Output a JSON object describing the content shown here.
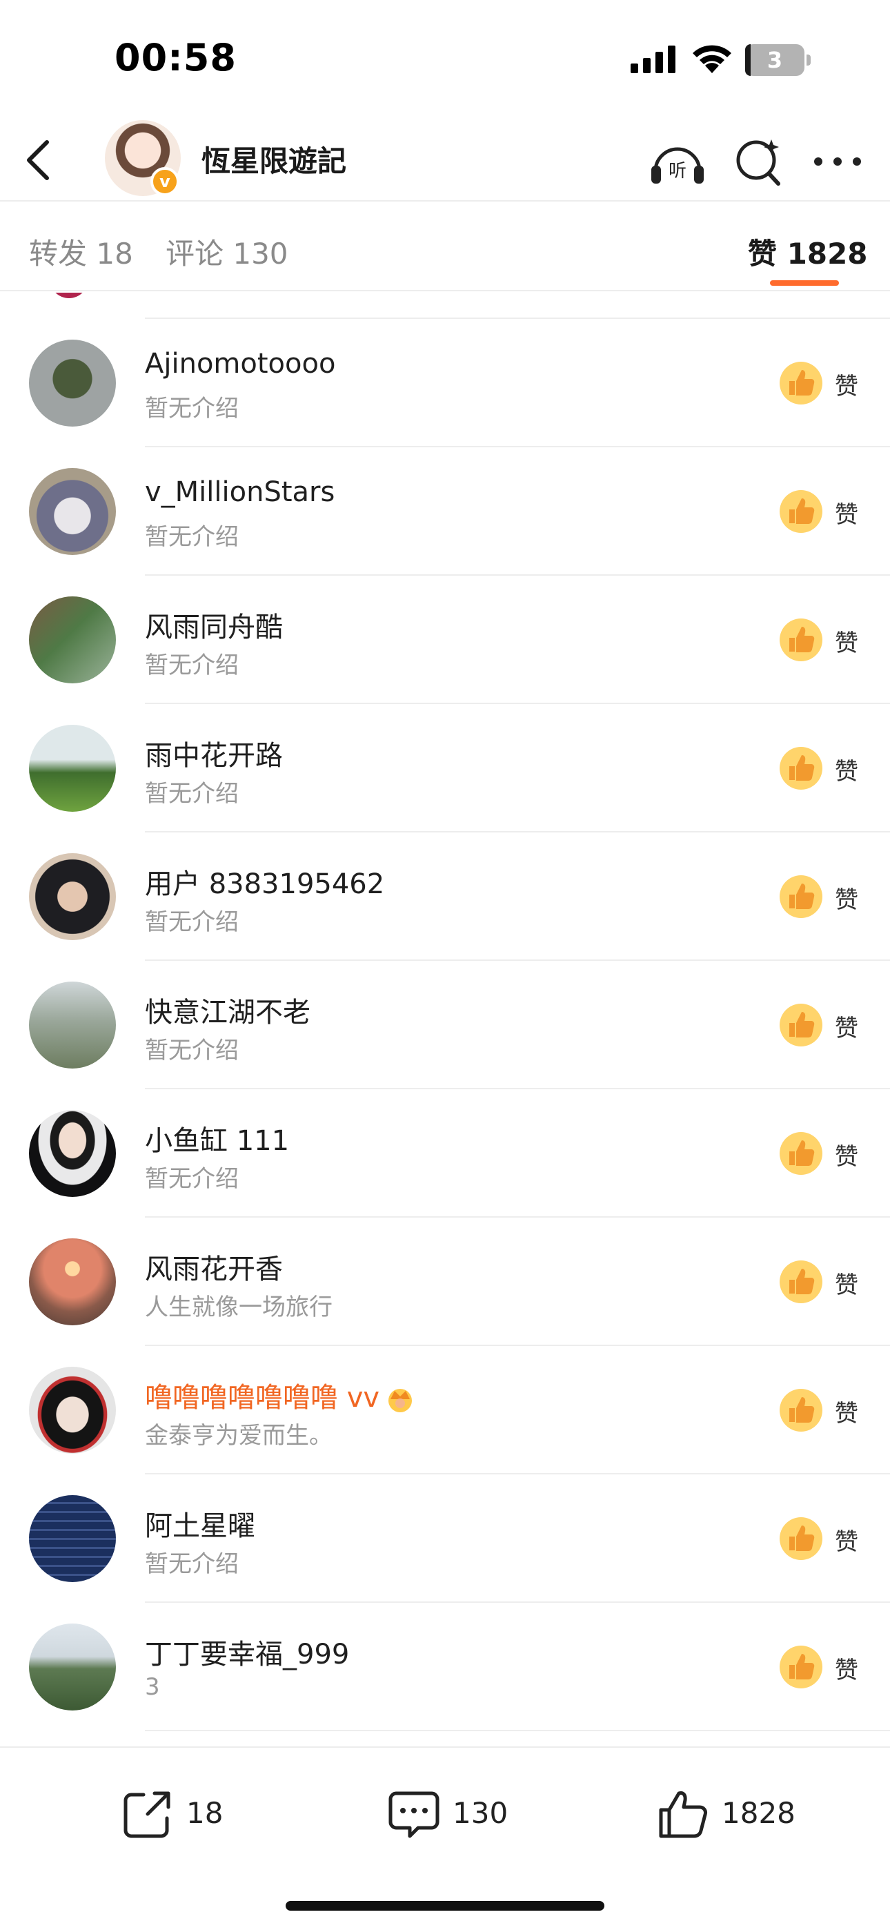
{
  "status_bar": {
    "time": "00:58",
    "battery": "3"
  },
  "nav": {
    "title": "恆星限遊記",
    "listen_icon_label": "听"
  },
  "tabs": [
    {
      "label": "转发 18"
    },
    {
      "label": "评论 130"
    },
    {
      "label": "赞 1828",
      "active": true
    }
  ],
  "likers": [
    {
      "name": "Ajinomotoooo",
      "bio": "暂无介绍",
      "action": "赞"
    },
    {
      "name": "v_MillionStars",
      "bio": "暂无介绍",
      "action": "赞"
    },
    {
      "name": "风雨同舟酷",
      "bio": "暂无介绍",
      "action": "赞"
    },
    {
      "name": "雨中花开路",
      "bio": "暂无介绍",
      "action": "赞"
    },
    {
      "name": "用户 8383195462",
      "bio": "暂无介绍",
      "action": "赞"
    },
    {
      "name": "快意江湖不老",
      "bio": "暂无介绍",
      "action": "赞"
    },
    {
      "name": "小鱼缸 111",
      "bio": "暂无介绍",
      "action": "赞"
    },
    {
      "name": "风雨花开香",
      "bio": "人生就像一场旅行",
      "action": "赞"
    },
    {
      "name": "噜噜噜噜噜噜噜 vv",
      "bio": "金泰亨为爱而生。",
      "action": "赞",
      "vip": true
    },
    {
      "name": "阿土星曜",
      "bio": "暂无介绍",
      "action": "赞"
    },
    {
      "name": "丁丁要幸福_999",
      "bio": "3",
      "action": "赞"
    }
  ],
  "bottom_bar": {
    "repost_count": "18",
    "comment_count": "130",
    "like_count": "1828"
  },
  "colors": {
    "accent": "#ff6b2d",
    "vip_name": "#f16622",
    "like_badge": "#ffd46b"
  }
}
